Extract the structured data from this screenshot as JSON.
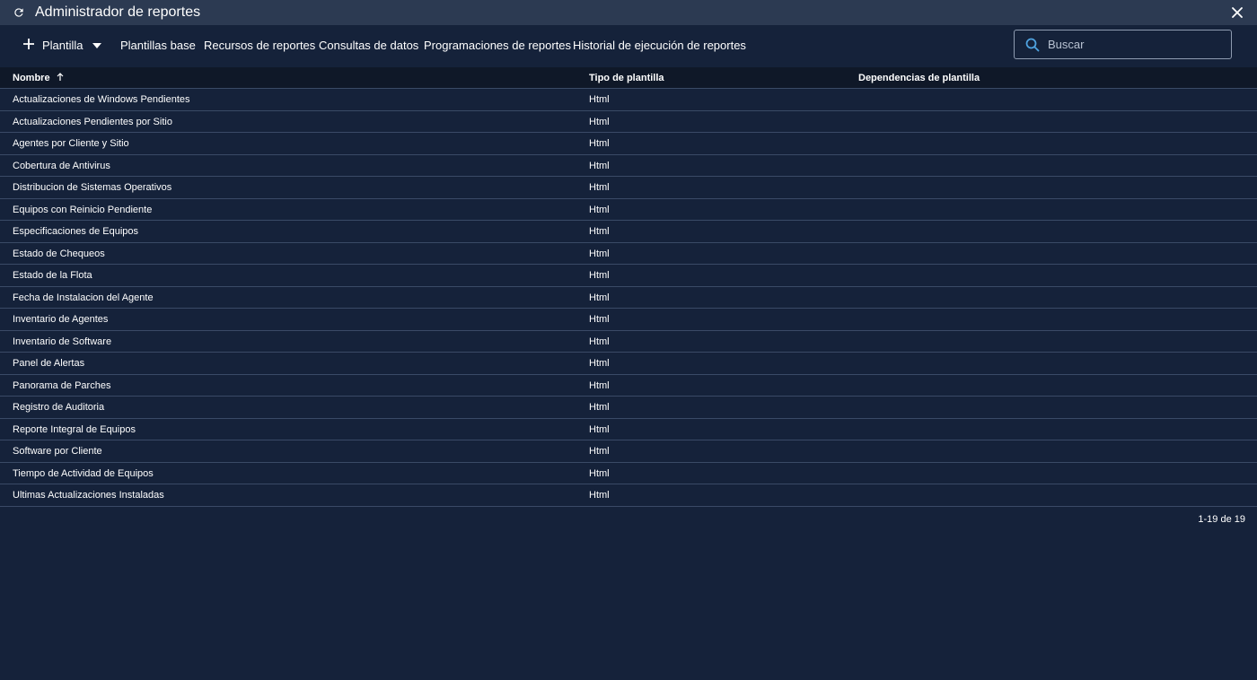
{
  "window": {
    "title": "Administrador de reportes"
  },
  "toolbar": {
    "add_template_label": "Plantilla",
    "buttons": [
      "Plantillas base",
      "Recursos de reportes",
      "Consultas de datos",
      "Programaciones de reportes",
      "Historial de ejecución de reportes"
    ]
  },
  "search": {
    "placeholder": "Buscar",
    "value": ""
  },
  "table": {
    "columns": [
      "Nombre",
      "Tipo de plantilla",
      "Dependencias de plantilla"
    ],
    "sort_column": "Nombre",
    "sort_direction": "asc",
    "rows": [
      [
        "Actualizaciones de Windows Pendientes",
        "Html",
        ""
      ],
      [
        "Actualizaciones Pendientes por Sitio",
        "Html",
        ""
      ],
      [
        "Agentes por Cliente y Sitio",
        "Html",
        ""
      ],
      [
        "Cobertura de Antivirus",
        "Html",
        ""
      ],
      [
        "Distribucion de Sistemas Operativos",
        "Html",
        ""
      ],
      [
        "Equipos con Reinicio Pendiente",
        "Html",
        ""
      ],
      [
        "Especificaciones de Equipos",
        "Html",
        ""
      ],
      [
        "Estado de Chequeos",
        "Html",
        ""
      ],
      [
        "Estado de la Flota",
        "Html",
        ""
      ],
      [
        "Fecha de Instalacion del Agente",
        "Html",
        ""
      ],
      [
        "Inventario de Agentes",
        "Html",
        ""
      ],
      [
        "Inventario de Software",
        "Html",
        ""
      ],
      [
        "Panel de Alertas",
        "Html",
        ""
      ],
      [
        "Panorama de Parches",
        "Html",
        ""
      ],
      [
        "Registro de Auditoria",
        "Html",
        ""
      ],
      [
        "Reporte Integral de Equipos",
        "Html",
        ""
      ],
      [
        "Software por Cliente",
        "Html",
        ""
      ],
      [
        "Tiempo de Actividad de Equipos",
        "Html",
        ""
      ],
      [
        "Ultimas Actualizaciones Instaladas",
        "Html",
        ""
      ]
    ]
  },
  "pagination": {
    "label": "1-19 de 19"
  },
  "colors": {
    "background": "#15223a",
    "titlebar": "#2c3a52",
    "header": "#0f1828",
    "divider": "#3a4a66",
    "search_icon": "#4fa3e0"
  }
}
